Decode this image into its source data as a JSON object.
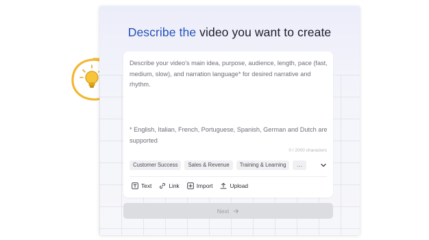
{
  "header": {
    "title_part1": "Describe the",
    "title_part2": " video you want to create"
  },
  "prompt": {
    "placeholder": "Describe your video's main idea, purpose, audience, length, pace (fast, medium, slow), and narration language* for desired narrative and rhythm.",
    "language_note": "* English, Italian, French, Portuguese, Spanish, German and Dutch are supported",
    "char_counter": "0 / 2000 characters"
  },
  "categories": {
    "chips": [
      "Customer Success",
      "Sales & Revenue",
      "Training & Learning"
    ],
    "more_label": "..."
  },
  "toolbar": {
    "text_label": "Text",
    "link_label": "Link",
    "import_label": "Import",
    "upload_label": "Upload"
  },
  "actions": {
    "next_label": "Next"
  },
  "colors": {
    "accent": "#2450b8",
    "bulb": "#f2b731"
  },
  "icons": {
    "decoration": "lightbulb-icon",
    "more": "chevron-down-icon",
    "text": "text-icon",
    "link": "link-icon",
    "import": "import-icon",
    "upload": "upload-icon",
    "next": "arrow-right-icon"
  }
}
